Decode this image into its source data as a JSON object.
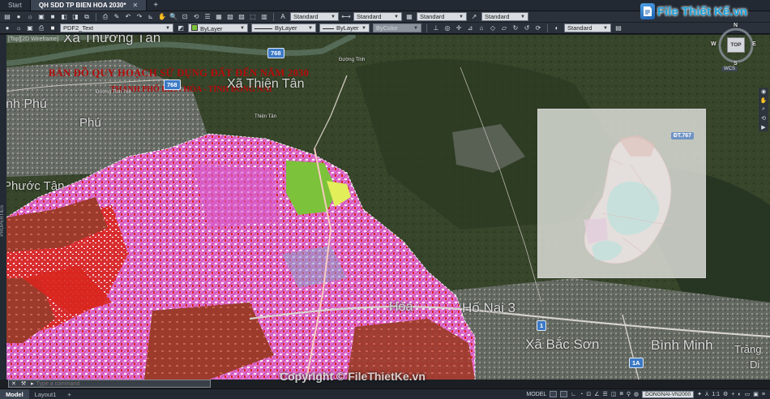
{
  "tabs": [
    {
      "label": "Start",
      "active": false
    },
    {
      "label": "QH SDD TP BIEN HOA 2030*",
      "active": true
    }
  ],
  "ribbon_row1": {
    "text_style": "Standard",
    "dim_style": "Standard",
    "table_style": "Standard",
    "mleader_style": "Standard"
  },
  "ribbon_row2": {
    "layer": "PDF2_Text",
    "color": "ByLayer",
    "linetype": "ByLayer",
    "lineweight": "ByLayer",
    "plot_style": "ByColor",
    "visual_style": "Standard"
  },
  "viewport": {
    "label": "[Top][2D Wireframe]"
  },
  "side_panel": {
    "label": "PROPERTIES"
  },
  "map": {
    "title": "BẢN ĐỒ QUY HOẠCH SỬ DỤNG ĐẤT ĐẾN NĂM 2030",
    "subtitle": "THÀNH PHỐ BIÊN HÒA - TỈNH ĐỒNG NAI",
    "places": [
      {
        "text": "Xã Thường Tân",
        "size": 17
      },
      {
        "text": "Xã Thiện Tân",
        "size": 16
      },
      {
        "text": "Bình Phú",
        "size": 16
      },
      {
        "text": "Phước Tân",
        "size": 15
      },
      {
        "text": "Hòa",
        "size": 16
      },
      {
        "text": "Hố Nai 3",
        "size": 17
      },
      {
        "text": "Xã Bắc Sơn",
        "size": 17
      },
      {
        "text": "Bình Minh",
        "size": 17
      },
      {
        "text": "Trảng",
        "size": 13
      },
      {
        "text": "Di",
        "size": 13
      },
      {
        "text": "Phú",
        "size": 15
      }
    ],
    "road_tags": [
      "768",
      "768",
      "1",
      "1A"
    ],
    "small_labels": [
      "Đường Tỉnh 768",
      "Đường Tỉnh",
      "Thiện Tân"
    ],
    "inset_tag": "ĐT.767",
    "colors": {
      "urban": "#e46fcf",
      "residential": "#d8261e",
      "industrial": "#9c3b2c",
      "green": "#7cc23a",
      "inset_cyan": "#39d2d2"
    }
  },
  "navcube": {
    "top": "TOP",
    "north": "N",
    "south": "S",
    "east": "E",
    "west": "W",
    "wcs": "WCS"
  },
  "command_line": {
    "placeholder": "Type a command"
  },
  "layout_tabs": [
    {
      "label": "Model",
      "active": true
    },
    {
      "label": "Layout1",
      "active": false
    }
  ],
  "status": {
    "space": "MODEL",
    "coordinate_system": "DONGNAI-VN2000",
    "annotation_scale": "1:1"
  },
  "watermarks": {
    "logo": "File Thiết Kế.vn",
    "copyright": "Copyright © FileThietKe.vn"
  }
}
